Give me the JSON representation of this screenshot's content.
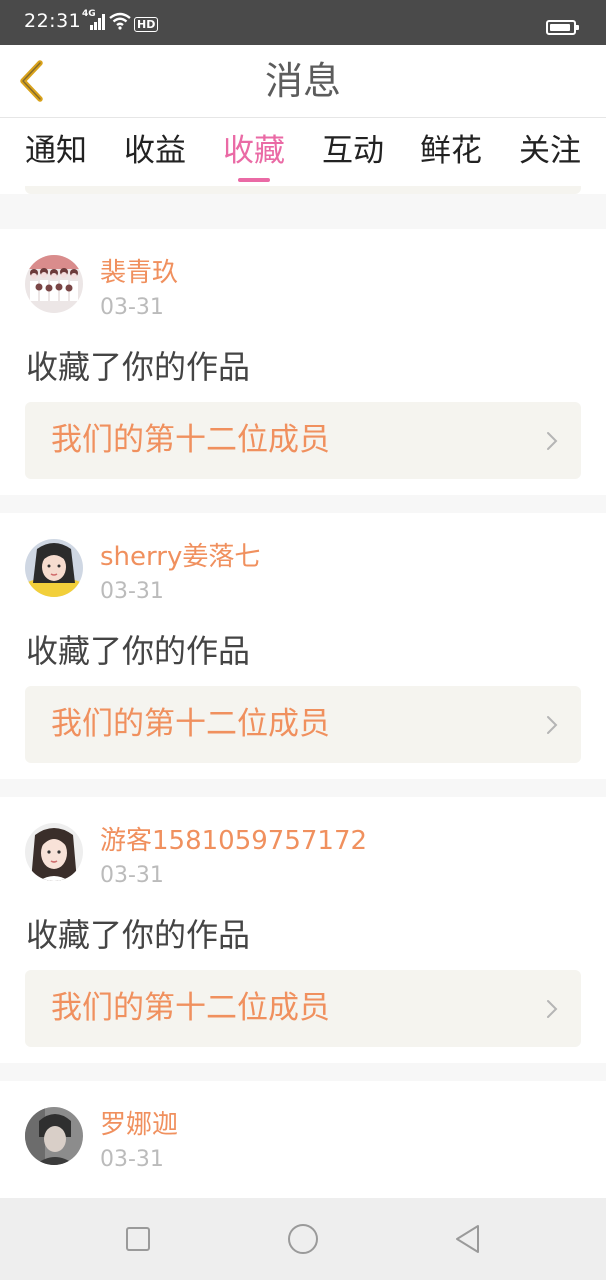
{
  "status_bar": {
    "time": "22:31",
    "network": "4G",
    "hd": "HD"
  },
  "header": {
    "title": "消息"
  },
  "tabs": [
    {
      "label": "通知",
      "active": false
    },
    {
      "label": "收益",
      "active": false
    },
    {
      "label": "收藏",
      "active": true
    },
    {
      "label": "互动",
      "active": false
    },
    {
      "label": "鲜花",
      "active": false
    },
    {
      "label": "关注",
      "active": false
    }
  ],
  "feed": [
    {
      "user": "裴青玖",
      "date": "03-31",
      "action": "收藏了你的作品",
      "work": "我们的第十二位成员"
    },
    {
      "user": "sherry姜落七",
      "date": "03-31",
      "action": "收藏了你的作品",
      "work": "我们的第十二位成员"
    },
    {
      "user": "游客1581059757172",
      "date": "03-31",
      "action": "收藏了你的作品",
      "work": "我们的第十二位成员"
    },
    {
      "user": "罗娜迦",
      "date": "03-31"
    }
  ],
  "colors": {
    "accent_pink": "#ea6aa5",
    "accent_orange": "#f0905e",
    "back_arrow": "#d9a21b"
  },
  "icons": {
    "back": "chevron-left-icon",
    "card_arrow": "chevron-right-icon",
    "nav": [
      "square-icon",
      "circle-icon",
      "triangle-back-icon"
    ]
  }
}
